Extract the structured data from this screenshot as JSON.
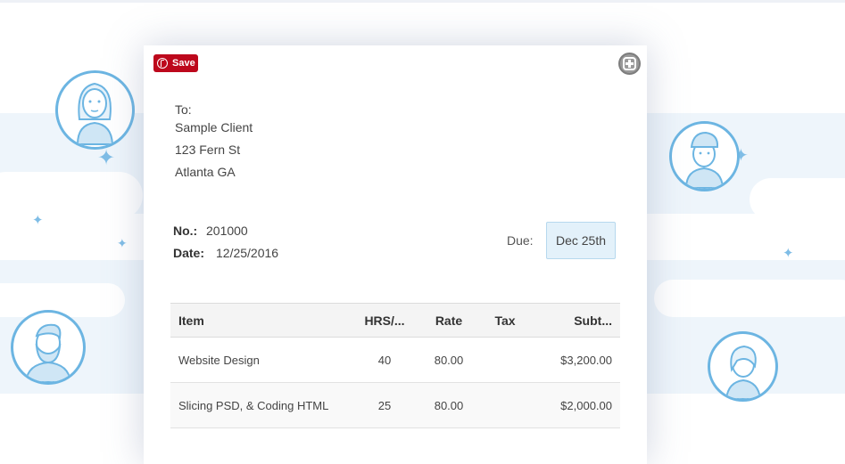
{
  "save_button": {
    "label": "Save",
    "icon": "pinterest-icon",
    "color": "#bd081c"
  },
  "expand_icon": "plus-circle-icon",
  "invoice": {
    "to_label": "To:",
    "client_name": "Sample Client",
    "address_line1": "123 Fern St",
    "address_line2": "Atlanta GA",
    "number_label": "No.:",
    "number_value": "201000",
    "date_label": "Date:",
    "date_value": "12/25/2016",
    "due_label": "Due:",
    "due_value": "Dec 25th"
  },
  "table": {
    "headers": {
      "item": "Item",
      "hrs": "HRS/...",
      "rate": "Rate",
      "tax": "Tax",
      "subtotal": "Subt..."
    },
    "rows": [
      {
        "item": "Website Design",
        "hrs": "40",
        "rate": "80.00",
        "tax": "",
        "subtotal": "$3,200.00"
      },
      {
        "item": "Slicing PSD, & Coding HTML",
        "hrs": "25",
        "rate": "80.00",
        "tax": "",
        "subtotal": "$2,000.00"
      }
    ]
  },
  "decor": {
    "accent_color": "#6cb5e2",
    "avatars": [
      "woman-avatar-icon",
      "beanie-man-avatar-icon",
      "bearded-man-avatar-icon",
      "girl-avatar-icon"
    ]
  }
}
